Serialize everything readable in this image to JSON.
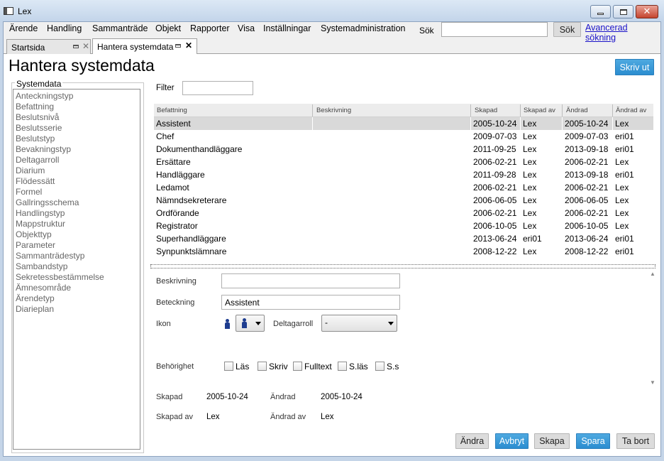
{
  "window": {
    "title": "Lex"
  },
  "menu": {
    "items": [
      "Ärende",
      "Handling",
      "Sammanträde",
      "Objekt",
      "Rapporter",
      "Visa",
      "Inställningar",
      "Systemadministration"
    ],
    "search_label": "Sök",
    "search_value": "",
    "search_button": "Sök",
    "advanced_search": "Avancerad sökning"
  },
  "tabs": [
    {
      "label": "Startsida",
      "active": false
    },
    {
      "label": "Hantera systemdata",
      "active": true
    }
  ],
  "page": {
    "title": "Hantera systemdata",
    "print_button": "Skriv ut"
  },
  "systemdata": {
    "legend": "Systemdata",
    "items": [
      "Anteckningstyp",
      "Befattning",
      "Beslutsnivå",
      "Beslutsserie",
      "Beslutstyp",
      "Bevakningstyp",
      "Deltagarroll",
      "Diarium",
      "Flödessätt",
      "Formel",
      "Gallringsschema",
      "Handlingstyp",
      "Mappstruktur",
      "Objekttyp",
      "Parameter",
      "Sammanträdestyp",
      "Sambandstyp",
      "Sekretessbestämmelse",
      "Ämnesområde",
      "Ärendetyp",
      "Diarieplan"
    ]
  },
  "filter": {
    "label": "Filter",
    "value": ""
  },
  "grid": {
    "columns": [
      "Befattning",
      "Beskrivning",
      "Skapad",
      "Skapad av",
      "Ändrad",
      "Ändrad av"
    ],
    "selected_index": 0,
    "rows": [
      [
        "Assistent",
        "",
        "2005-10-24",
        "Lex",
        "2005-10-24",
        "Lex"
      ],
      [
        "Chef",
        "",
        "2009-07-03",
        "Lex",
        "2009-07-03",
        "eri01"
      ],
      [
        "Dokumenthandläggare",
        "",
        "2011-09-25",
        "Lex",
        "2013-09-18",
        "eri01"
      ],
      [
        "Ersättare",
        "",
        "2006-02-21",
        "Lex",
        "2006-02-21",
        "Lex"
      ],
      [
        "Handläggare",
        "",
        "2011-09-28",
        "Lex",
        "2013-09-18",
        "eri01"
      ],
      [
        "Ledamot",
        "",
        "2006-02-21",
        "Lex",
        "2006-02-21",
        "Lex"
      ],
      [
        "Nämndsekreterare",
        "",
        "2006-06-05",
        "Lex",
        "2006-06-05",
        "Lex"
      ],
      [
        "Ordförande",
        "",
        "2006-02-21",
        "Lex",
        "2006-02-21",
        "Lex"
      ],
      [
        "Registrator",
        "",
        "2006-10-05",
        "Lex",
        "2006-10-05",
        "Lex"
      ],
      [
        "Superhandläggare",
        "",
        "2013-06-24",
        "eri01",
        "2013-06-24",
        "eri01"
      ],
      [
        "Synpunktslämnare",
        "",
        "2008-12-22",
        "Lex",
        "2008-12-22",
        "eri01"
      ]
    ]
  },
  "detail": {
    "beskrivning_label": "Beskrivning",
    "beskrivning_value": "",
    "beteckning_label": "Beteckning",
    "beteckning_value": "Assistent",
    "ikon_label": "Ikon",
    "deltagarroll_label": "Deltagarroll",
    "deltagarroll_value": "-",
    "behorighet_label": "Behörighet",
    "permissions": [
      "Läs",
      "Skriv",
      "Fulltext",
      "S.läs",
      "S.s"
    ],
    "skapad_label": "Skapad",
    "skapad_value": "2005-10-24",
    "andrad_label": "Ändrad",
    "andrad_value": "2005-10-24",
    "skapad_av_label": "Skapad av",
    "skapad_av_value": "Lex",
    "andrad_av_label": "Ändrad av",
    "andrad_av_value": "Lex"
  },
  "actions": {
    "andra": "Ändra",
    "avbryt": "Avbryt",
    "skapa": "Skapa",
    "spara": "Spara",
    "ta_bort": "Ta bort"
  },
  "colors": {
    "accent": "#2b8dd0",
    "selected_row": "#d9d9d9"
  }
}
